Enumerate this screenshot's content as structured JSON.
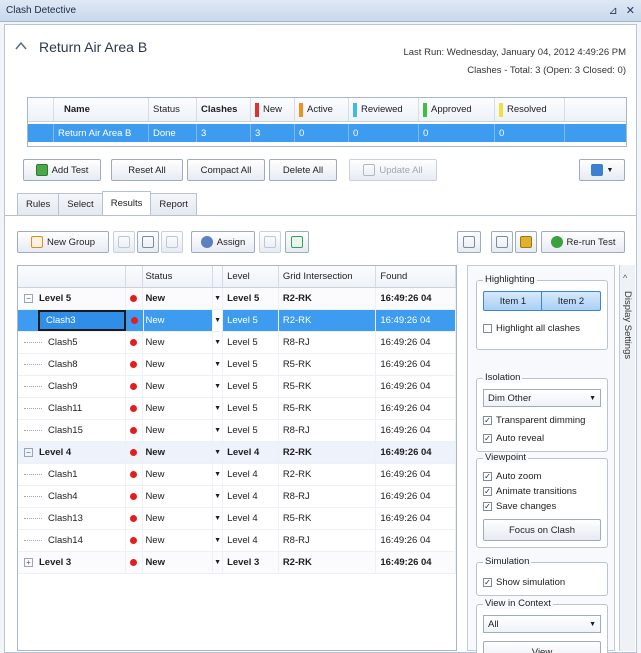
{
  "window": {
    "title": "Clash Detective",
    "pin_glyph": "⊿",
    "close_glyph": "✕"
  },
  "test": {
    "name": "Return Air Area B",
    "last_run": "Last Run:  Wednesday, January 04, 2012 4:49:26 PM",
    "totals": "Clashes - Total:  3  (Open:  3  Closed:  0)"
  },
  "test_table": {
    "headers": [
      "Name",
      "Status",
      "Clashes",
      "New",
      "Active",
      "Reviewed",
      "Approved",
      "Resolved"
    ],
    "row": [
      "Return Air Area B",
      "Done",
      "3",
      "3",
      "0",
      "0",
      "0",
      "0"
    ],
    "colors": {
      "new": "#e03030",
      "active": "#f09020",
      "reviewed": "#40b8e8",
      "approved": "#40c040",
      "resolved": "#f0e040"
    }
  },
  "toolbar": {
    "add_test": "Add Test",
    "reset_all": "Reset All",
    "compact_all": "Compact All",
    "delete_all": "Delete All",
    "update_all": "Update All"
  },
  "tabs": [
    "Rules",
    "Select",
    "Results",
    "Report"
  ],
  "results_toolbar": {
    "new_group": "New Group",
    "assign": "Assign",
    "rerun": "Re-run Test"
  },
  "grid": {
    "headers": [
      "",
      "",
      "Status",
      "",
      "Level",
      "Grid Intersection",
      "Found"
    ],
    "rows": [
      {
        "kind": "group",
        "name": "Level 5",
        "status": "New",
        "level": "Level 5",
        "grid": "R2-RK",
        "found": "16:49:26 04"
      },
      {
        "kind": "selected",
        "name": "Clash3",
        "status": "New",
        "level": "Level 5",
        "grid": "R2-RK",
        "found": "16:49:26 04"
      },
      {
        "kind": "item",
        "name": "Clash5",
        "status": "New",
        "level": "Level 5",
        "grid": "R8-RJ",
        "found": "16:49:26 04"
      },
      {
        "kind": "item",
        "name": "Clash8",
        "status": "New",
        "level": "Level 5",
        "grid": "R5-RK",
        "found": "16:49:26 04"
      },
      {
        "kind": "item",
        "name": "Clash9",
        "status": "New",
        "level": "Level 5",
        "grid": "R5-RK",
        "found": "16:49:26 04"
      },
      {
        "kind": "item",
        "name": "Clash11",
        "status": "New",
        "level": "Level 5",
        "grid": "R5-RK",
        "found": "16:49:26 04"
      },
      {
        "kind": "item",
        "name": "Clash15",
        "status": "New",
        "level": "Level 5",
        "grid": "R8-RJ",
        "found": "16:49:26 04"
      },
      {
        "kind": "group-alt",
        "name": "Level 4",
        "status": "New",
        "level": "Level 4",
        "grid": "R2-RK",
        "found": "16:49:26 04"
      },
      {
        "kind": "item",
        "name": "Clash1",
        "status": "New",
        "level": "Level 4",
        "grid": "R2-RK",
        "found": "16:49:26 04"
      },
      {
        "kind": "item",
        "name": "Clash4",
        "status": "New",
        "level": "Level 4",
        "grid": "R8-RJ",
        "found": "16:49:26 04"
      },
      {
        "kind": "item",
        "name": "Clash13",
        "status": "New",
        "level": "Level 4",
        "grid": "R5-RK",
        "found": "16:49:26 04"
      },
      {
        "kind": "item",
        "name": "Clash14",
        "status": "New",
        "level": "Level 4",
        "grid": "R8-RJ",
        "found": "16:49:26 04"
      },
      {
        "kind": "group",
        "name": "Level 3",
        "status": "New",
        "level": "Level 3",
        "grid": "R2-RK",
        "found": "16:49:26 04"
      }
    ]
  },
  "display_settings": {
    "tab_label": "Display Settings",
    "highlighting": {
      "title": "Highlighting",
      "item1": "Item 1",
      "item2": "Item 2",
      "highlight_all": "Highlight all clashes"
    },
    "isolation": {
      "title": "Isolation",
      "dim_option": "Dim Other",
      "transparent_dimming": "Transparent dimming",
      "auto_reveal": "Auto reveal"
    },
    "viewpoint": {
      "title": "Viewpoint",
      "auto_zoom": "Auto zoom",
      "animate_transitions": "Animate transitions",
      "save_changes": "Save changes",
      "focus_button": "Focus on Clash"
    },
    "simulation": {
      "title": "Simulation",
      "show_simulation": "Show simulation"
    },
    "view_in_context": {
      "title": "View in Context",
      "option": "All",
      "view_button": "View"
    }
  }
}
